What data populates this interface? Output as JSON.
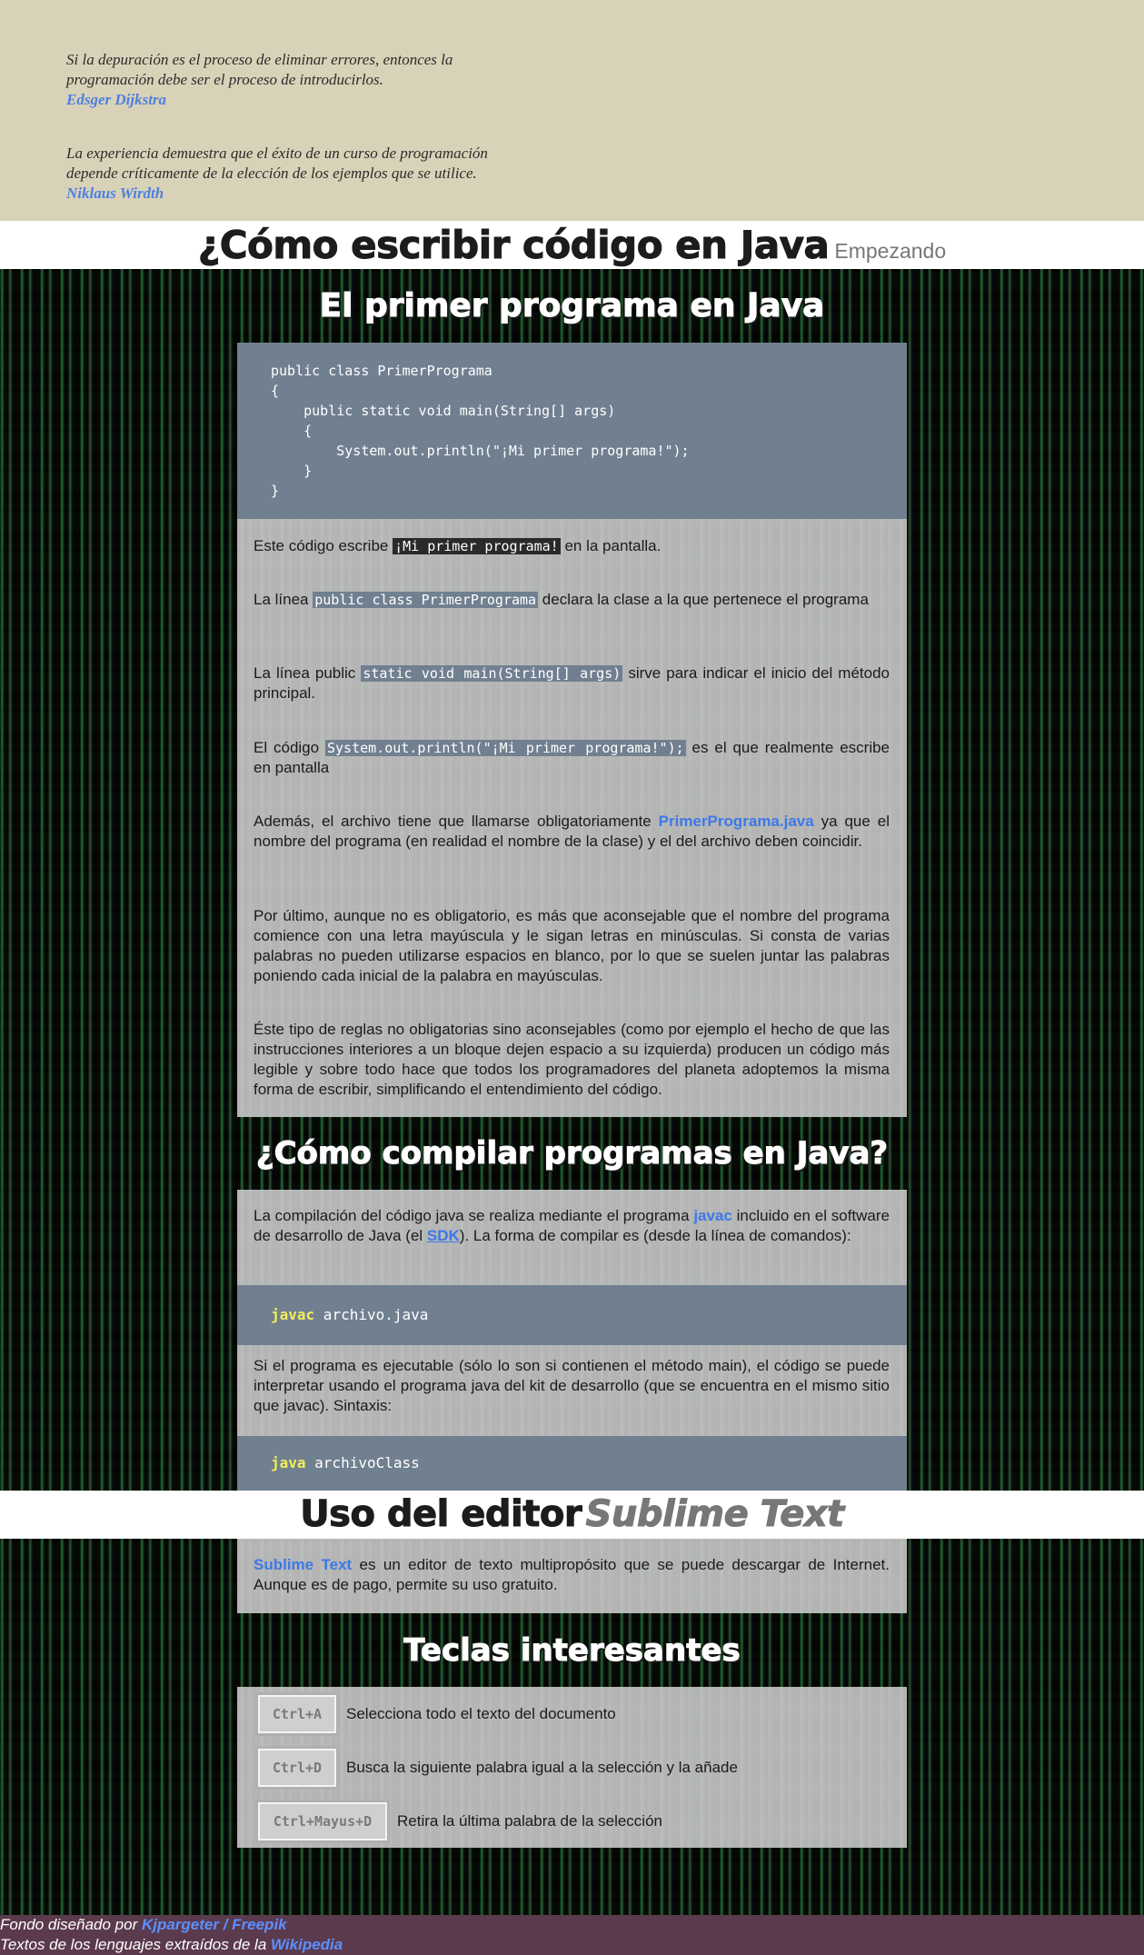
{
  "quotes": [
    {
      "text_line1": "Si la depuración es el proceso de eliminar errores, entonces la",
      "text_line2": "programación debe ser el proceso de introducirlos.",
      "author": "Edsger Dijkstra"
    },
    {
      "text_line1": "La experiencia demuestra que el éxito de un curso de programación",
      "text_line2": "depende críticamente de la elección de los ejemplos que se utilice.",
      "author": "Niklaus Wirdth"
    }
  ],
  "header": {
    "title": "¿Cómo escribir código en Java",
    "subtitle": "Empezando"
  },
  "section1": {
    "title": "El primer programa en Java",
    "code": [
      "public class PrimerPrograma",
      "{",
      "    public static void main(String[] args)",
      "    {",
      "        System.out.println(\"¡Mi primer programa!\");",
      "    }",
      "}"
    ],
    "p1": {
      "pre": "Este código escribe ",
      "code": "¡Mi primer programa!",
      "post": " en la pantalla."
    },
    "p2": {
      "pre": "La línea ",
      "code": "public class PrimerPrograma",
      "post": " declara la clase a la que pertenece el programa"
    },
    "p3": {
      "pre": "La línea public ",
      "code": "static void main(String[] args)",
      "post": " sirve para indicar el inicio del método principal."
    },
    "p4": {
      "pre": "El código ",
      "code": "System.out.println(\"¡Mi primer programa!\");",
      "post": " es el que realmente escribe en pantalla"
    },
    "p5": {
      "pre": "Además, el archivo tiene que llamarse obligatoriamente ",
      "highlight": "PrimerPrograma.java",
      "post": " ya que el nombre del programa (en realidad el nombre de la clase) y el del archivo deben coincidir."
    },
    "p6": "Por último, aunque no es obligatorio, es más que aconsejable que el nombre del programa comience con una letra mayúscula y le sigan letras en minúsculas. Si consta de varias palabras no pueden utilizarse espacios en blanco, por lo que se suelen juntar las palabras poniendo cada inicial de la palabra en mayúsculas.",
    "p7": "Éste tipo de reglas no obligatorias sino aconsejables (como por ejemplo el hecho de que las instrucciones interiores a un bloque dejen espacio a su izquierda) producen un código más legible y sobre todo hace que todos los programadores del planeta adoptemos la misma forma de escribir, simplificando el entendimiento del código."
  },
  "section2": {
    "title": "¿Cómo compilar programas en Java?",
    "p1": {
      "pre": "La compilación del código java se realiza mediante el programa ",
      "highlight": "javac",
      "mid": " incluido en el software de desarrollo de Java (el ",
      "link": "SDK",
      "post": "). La forma de compilar es (desde la línea de comandos):"
    },
    "code1": {
      "kw": "javac",
      "rest": " archivo.java"
    },
    "p2": "Si el programa es ejecutable (sólo lo son si contienen el método main), el código se puede interpretar usando el programa java del kit de desarrollo (que se encuentra en el mismo sitio que javac). Sintaxis:",
    "code2": {
      "kw": "java",
      "rest": " archivoClass"
    }
  },
  "section3": {
    "title_main": "Uso del editor",
    "title_em": "Sublime Text",
    "p1": {
      "highlight": "Sublime Text",
      "post": " es un editor de texto multipropósito que se puede descargar de Internet. Aunque es de pago, permite su uso gratuito."
    }
  },
  "section4": {
    "title": "Teclas interesantes",
    "keys": [
      {
        "key": "Ctrl+A",
        "desc": "Selecciona todo el texto del documento"
      },
      {
        "key": "Ctrl+D",
        "desc": "Busca la siguiente palabra igual a la selección y la añade"
      },
      {
        "key": "Ctrl+Mayus+D",
        "desc": "Retira la última palabra de la selección"
      }
    ]
  },
  "footer": {
    "line1_pre": "Fondo diseñado por ",
    "line1_link": "Kjpargeter / Freepik",
    "line2_pre": "Textos de los lenguajes extraídos de la ",
    "line2_link": "Wikipedia"
  }
}
